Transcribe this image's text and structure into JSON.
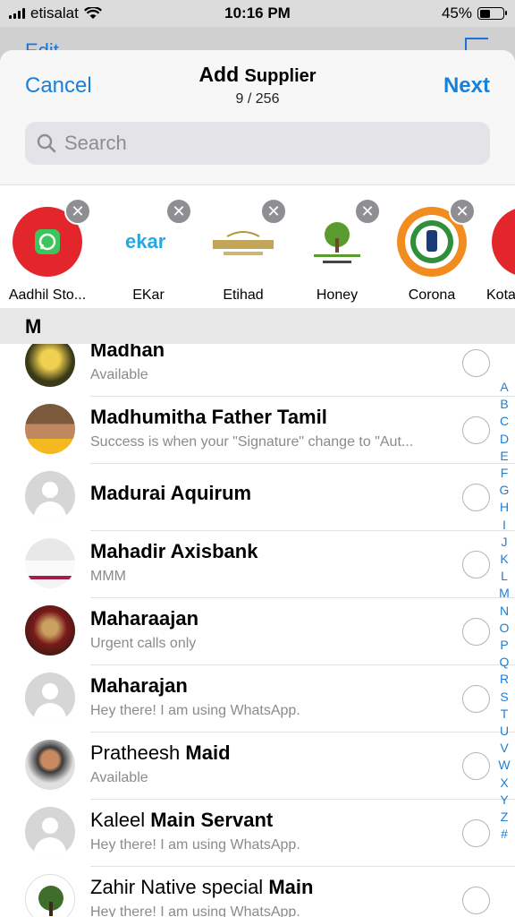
{
  "status_bar": {
    "carrier": "etisalat",
    "time": "10:16 PM",
    "battery_text": "45%",
    "battery_level": 0.45
  },
  "behind": {
    "edit_label": "Edit"
  },
  "header": {
    "cancel_label": "Cancel",
    "title_prefix": "Add",
    "title_emphasis": "Supplier",
    "count": "9 / 256",
    "next_label": "Next"
  },
  "search": {
    "placeholder": "Search"
  },
  "selected": [
    {
      "label": "Aadhil Sto...",
      "avatar": "whatsapp-red-badge",
      "color": "#e3262b"
    },
    {
      "label": "EKar",
      "avatar": "ekar-logo",
      "color": "#29a8e0"
    },
    {
      "label": "Etihad",
      "avatar": "etihad-logo",
      "color": "#b6953b"
    },
    {
      "label": "Honey",
      "avatar": "tree-logo",
      "color": "#5a9b2e"
    },
    {
      "label": "Corona",
      "avatar": "corona-seal",
      "color": "#f28c1e"
    },
    {
      "label": "Kota",
      "avatar": "kota-logo",
      "color": "#e3262b"
    }
  ],
  "section": {
    "letter": "M"
  },
  "contacts": [
    {
      "name": "Madhan",
      "bold": "",
      "status": "Available",
      "avatar": "photo"
    },
    {
      "name": "Madhumitha Father Tamil",
      "bold": "",
      "status": "Success is when your \"Signature\" change to \"Aut...",
      "avatar": "photo"
    },
    {
      "name": "Madurai Aquirum",
      "bold": "",
      "status": "",
      "avatar": "default"
    },
    {
      "name": "Mahadir Axisbank",
      "bold": "",
      "status": "MMM",
      "avatar": "photo"
    },
    {
      "name": "Maharaajan",
      "bold": "",
      "status": "Urgent calls only",
      "avatar": "photo"
    },
    {
      "name": "Maharajan",
      "bold": "",
      "status": "Hey there! I am using WhatsApp.",
      "avatar": "default"
    },
    {
      "name": "Pratheesh ",
      "bold": "Maid",
      "status": "Available",
      "avatar": "photo"
    },
    {
      "name": "Kaleel ",
      "bold": "Main Servant",
      "status": "Hey there! I am using WhatsApp.",
      "avatar": "default"
    },
    {
      "name": "Zahir Native special ",
      "bold": "Main",
      "status": "Hey there! I am using WhatsApp.",
      "avatar": "tree-logo"
    }
  ],
  "alpha_index": [
    "A",
    "B",
    "C",
    "D",
    "E",
    "F",
    "G",
    "H",
    "I",
    "J",
    "K",
    "L",
    "M",
    "N",
    "O",
    "P",
    "Q",
    "R",
    "S",
    "T",
    "U",
    "V",
    "W",
    "X",
    "Y",
    "Z",
    "#"
  ],
  "colors": {
    "accent": "#1a7fd9",
    "chip_remove": "#8e8e93"
  }
}
